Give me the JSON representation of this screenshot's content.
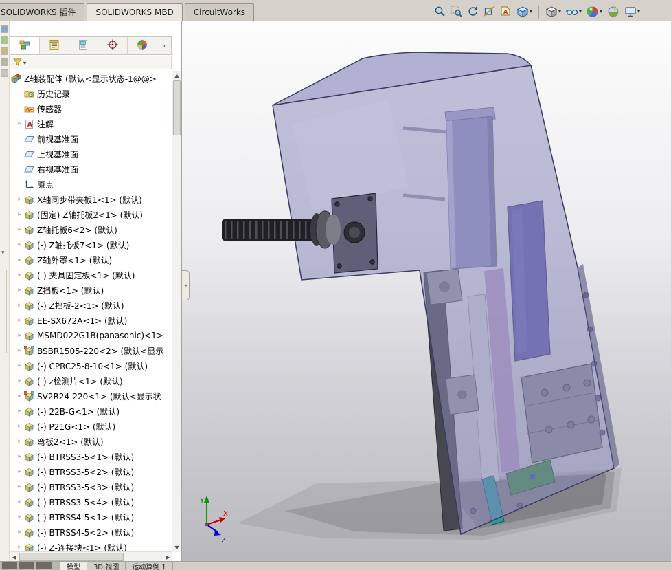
{
  "tabs": {
    "items": [
      {
        "label": "SOLIDWORKS 插件"
      },
      {
        "label": "SOLIDWORKS MBD"
      },
      {
        "label": "CircuitWorks"
      }
    ]
  },
  "hud": {
    "icons": [
      {
        "name": "zoom-to-fit",
        "caret": false
      },
      {
        "name": "zoom-to-area",
        "caret": false
      },
      {
        "name": "previous-view",
        "caret": false
      },
      {
        "name": "section-view",
        "caret": false
      },
      {
        "name": "annotation-views",
        "caret": false
      },
      {
        "name": "view-orientation",
        "caret": true,
        "sep_after": true
      },
      {
        "name": "display-style",
        "caret": true
      },
      {
        "name": "hide-show-items",
        "caret": true
      },
      {
        "name": "edit-appearance",
        "caret": true
      },
      {
        "name": "apply-scene",
        "caret": false
      },
      {
        "name": "view-settings",
        "caret": true
      }
    ]
  },
  "panel": {
    "tabs": [
      {
        "name": "featuremanager-tab",
        "active": true
      },
      {
        "name": "propertymanager-tab",
        "active": false
      },
      {
        "name": "configurationmanager-tab",
        "active": false
      },
      {
        "name": "dimxpertmanager-tab",
        "active": false
      },
      {
        "name": "displaymanager-tab",
        "active": false
      }
    ],
    "more_label": "›",
    "filter_caret": "▾"
  },
  "tree": {
    "root": {
      "label": "Z轴装配体 (默认<显示状态-1@@>"
    },
    "items": [
      {
        "icon": "history",
        "label": "历史记录",
        "arrow": false
      },
      {
        "icon": "sensor",
        "label": "传感器",
        "arrow": false
      },
      {
        "icon": "annotation",
        "label": "注解",
        "arrow": true
      },
      {
        "icon": "plane",
        "label": "前视基准面",
        "arrow": false
      },
      {
        "icon": "plane",
        "label": "上视基准面",
        "arrow": false
      },
      {
        "icon": "plane",
        "label": "右视基准面",
        "arrow": false
      },
      {
        "icon": "origin",
        "label": "原点",
        "arrow": false
      },
      {
        "icon": "part",
        "label": "X轴同步带夹板1<1> (默认)",
        "arrow": true
      },
      {
        "icon": "part",
        "label": "(固定) Z轴托板2<1> (默认)",
        "arrow": true
      },
      {
        "icon": "part",
        "label": "Z轴托板6<2> (默认)",
        "arrow": true
      },
      {
        "icon": "part",
        "label": "(-) Z轴托板7<1> (默认)",
        "arrow": true
      },
      {
        "icon": "part",
        "label": "Z轴外罩<1> (默认)",
        "arrow": true
      },
      {
        "icon": "part",
        "label": "(-) 夹具固定板<1> (默认)",
        "arrow": true
      },
      {
        "icon": "part",
        "label": "Z挡板<1> (默认)",
        "arrow": true
      },
      {
        "icon": "part",
        "label": "(-) Z挡板-2<1> (默认)",
        "arrow": true
      },
      {
        "icon": "part",
        "label": "EE-SX672A<1> (默认)",
        "arrow": true
      },
      {
        "icon": "part",
        "label": "MSMD022G1B(panasonic)<1>",
        "arrow": true
      },
      {
        "icon": "subasm",
        "label": "BSBR1505-220<2> (默认<显示",
        "arrow": true
      },
      {
        "icon": "part",
        "label": "(-) CPRC25-8-10<1> (默认)",
        "arrow": true
      },
      {
        "icon": "part",
        "label": "(-) z检测片<1> (默认)",
        "arrow": true
      },
      {
        "icon": "subasm",
        "label": "SV2R24-220<1> (默认<显示状",
        "arrow": true
      },
      {
        "icon": "part",
        "label": "(-) 22B-G<1> (默认)",
        "arrow": true
      },
      {
        "icon": "part",
        "label": "(-) P21G<1> (默认)",
        "arrow": true
      },
      {
        "icon": "part",
        "label": "弯板2<1> (默认)",
        "arrow": true
      },
      {
        "icon": "part",
        "label": "(-) BTRSS3-5<1> (默认)",
        "arrow": true
      },
      {
        "icon": "part",
        "label": "(-) BTRSS3-5<2> (默认)",
        "arrow": true
      },
      {
        "icon": "part",
        "label": "(-) BTRSS3-5<3> (默认)",
        "arrow": true
      },
      {
        "icon": "part",
        "label": "(-) BTRSS3-5<4> (默认)",
        "arrow": true
      },
      {
        "icon": "part",
        "label": "(-) BTRSS4-5<1> (默认)",
        "arrow": true
      },
      {
        "icon": "part",
        "label": "(-) BTRSS4-5<2> (默认)",
        "arrow": true
      },
      {
        "icon": "part",
        "label": "(-) Z-连接块<1> (默认)",
        "arrow": true
      }
    ]
  },
  "viewport": {
    "triad": {
      "x": "X",
      "y": "Y",
      "z": "Z"
    },
    "model_colors": {
      "cover": "#8a8abc",
      "motor": "#9494c2",
      "plate": "#5a5aaa",
      "base": "#3d8a44"
    }
  },
  "statusbar": {
    "tabs": [
      {
        "label": "模型"
      },
      {
        "label": "3D 视图"
      },
      {
        "label": "运动算例 1"
      }
    ]
  }
}
